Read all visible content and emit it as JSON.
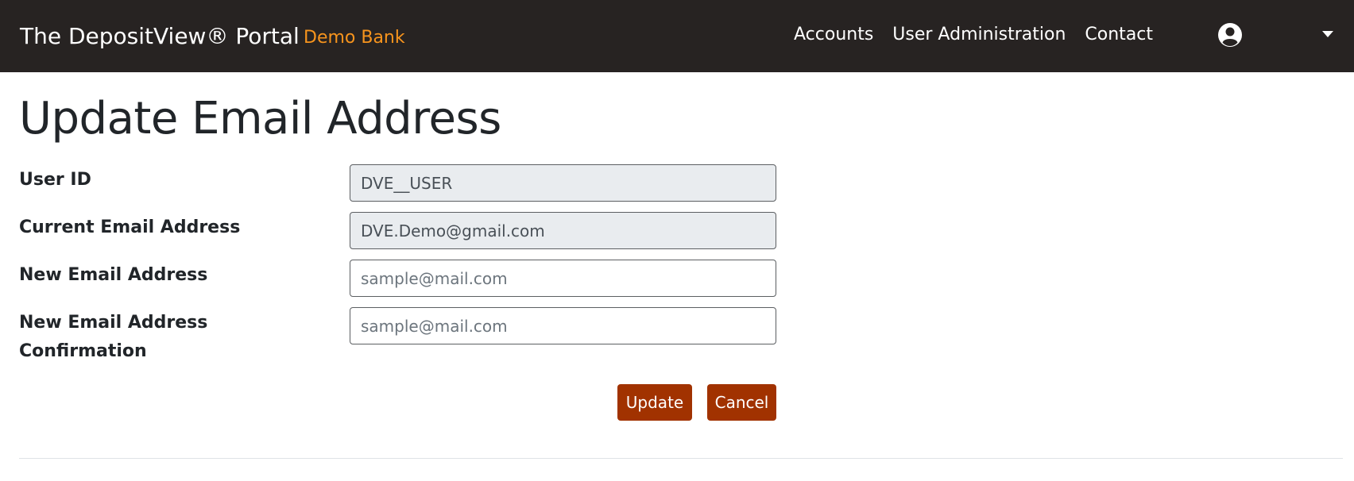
{
  "navbar": {
    "brand": "The DepositView® Portal",
    "bank_name": "Demo Bank",
    "links": [
      "Accounts",
      "User Administration",
      "Contact"
    ],
    "user_icon": "user-circle-icon",
    "caret_icon": "caret-down-icon"
  },
  "page": {
    "title": "Update Email Address"
  },
  "form": {
    "user_id_label": "User ID",
    "user_id_value": "DVE__USER",
    "current_email_label": "Current Email Address",
    "current_email_value": "DVE.Demo@gmail.com",
    "new_email_label": "New Email Address",
    "new_email_placeholder": "sample@mail.com",
    "confirm_label_line1": "New Email Address",
    "confirm_label_line2": "Confirmation",
    "confirm_placeholder": "sample@mail.com"
  },
  "actions": {
    "update_label": "Update",
    "cancel_label": "Cancel"
  },
  "colors": {
    "navbar_bg": "#272322",
    "bank_accent": "#f7941d",
    "button_bg": "#a13200"
  }
}
